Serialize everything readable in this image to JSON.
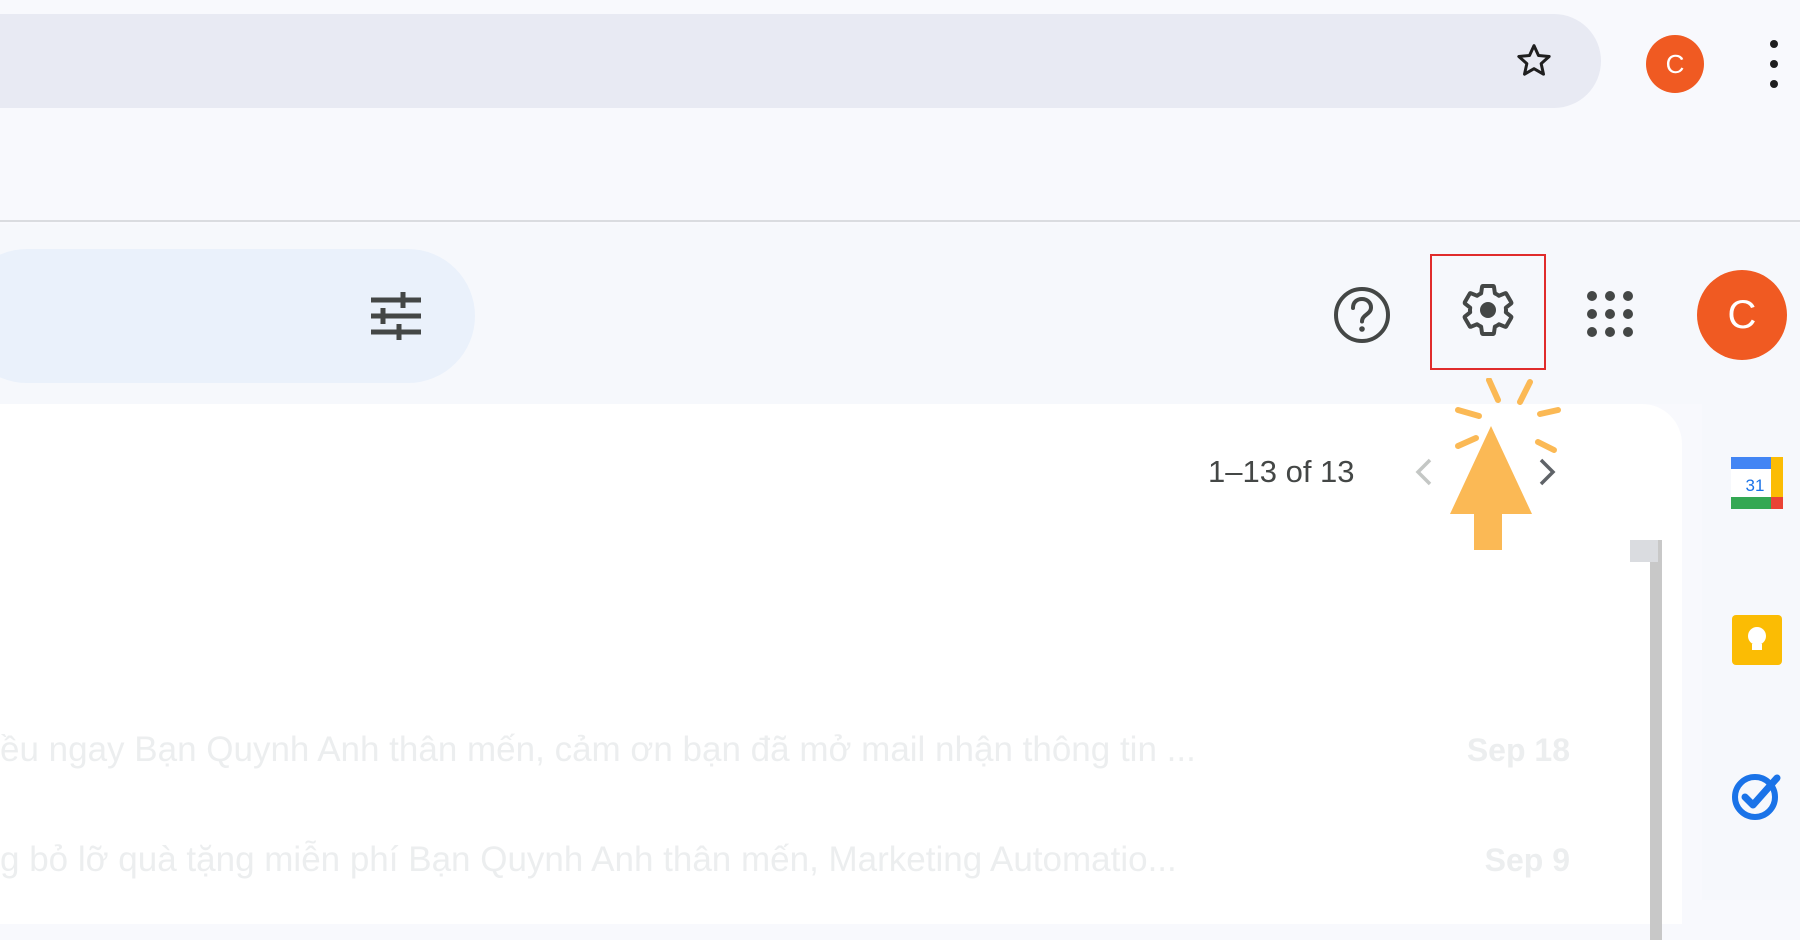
{
  "browser": {
    "profile_initial": "C",
    "bookmark_icon": "star-outline-icon",
    "menu_icon": "more-vert-icon"
  },
  "header": {
    "search_filter_icon": "tune-icon",
    "help_icon": "help-icon",
    "settings_icon": "gear-icon",
    "apps_icon": "apps-grid-icon",
    "profile_initial": "C"
  },
  "pager": {
    "range_label": "1–13 of 13",
    "prev_icon": "chevron-left-icon",
    "next_icon": "chevron-right-icon"
  },
  "emails": [
    {
      "snippet": "ều ngay Bạn Quynh Anh thân mến, cảm ơn bạn đã mở mail nhận thông tin ...",
      "date": "Sep 18"
    },
    {
      "snippet": "g bỏ lỡ quà tặng miễn phí Bạn Quynh Anh thân mến, Marketing Automatio...",
      "date": "Sep 9"
    }
  ],
  "side_panel": {
    "calendar_day": "31",
    "items": [
      "calendar-icon",
      "keep-icon",
      "tasks-icon"
    ]
  },
  "colors": {
    "avatar": "#f05a22",
    "highlight_box": "#e02c2c",
    "click_hint": "#fbb955"
  }
}
